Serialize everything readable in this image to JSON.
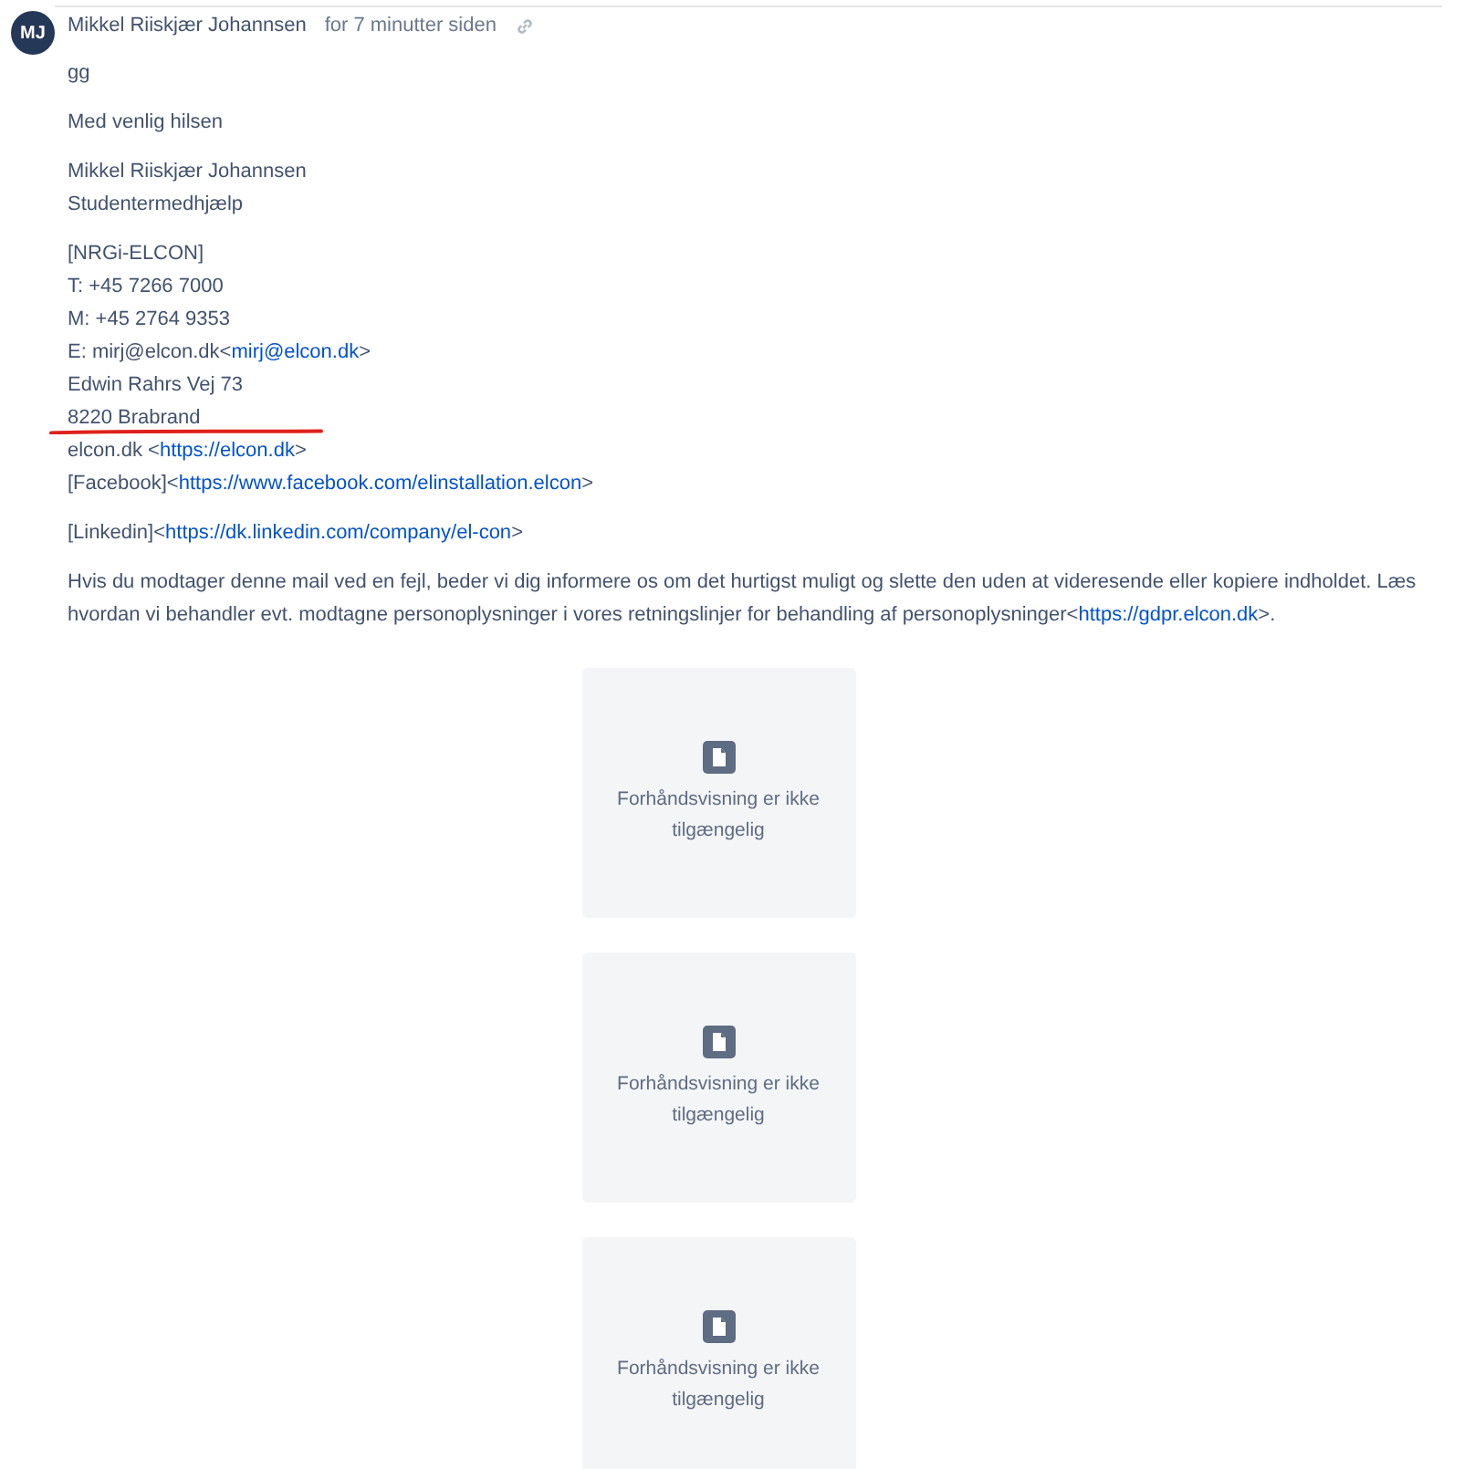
{
  "comment": {
    "avatar_initials": "MJ",
    "author": "Mikkel Riiskjær Johannsen",
    "time": "for 7 minutter siden",
    "paragraphs": [
      [
        [
          {
            "text": "gg"
          }
        ]
      ],
      [
        [
          {
            "text": "Med venlig hilsen"
          }
        ]
      ],
      [
        [
          {
            "text": "Mikkel Riiskjær Johannsen"
          }
        ],
        [
          {
            "text": "Studentermedhjælp"
          }
        ]
      ],
      [
        [
          {
            "text": "[NRGi-ELCON]"
          }
        ],
        [
          {
            "text": "T: +45 7266 7000"
          }
        ],
        [
          {
            "text": "M: +45 2764 9353"
          }
        ],
        [
          {
            "text": "E: mirj@elcon.dk<"
          },
          {
            "text": "mirj@elcon.dk",
            "link": true
          },
          {
            "text": ">"
          }
        ],
        [
          {
            "text": "Edwin Rahrs Vej 73"
          }
        ],
        [
          {
            "text": "8220 Brabrand"
          }
        ],
        [
          {
            "text": "elcon.dk <"
          },
          {
            "text": "https://elcon.dk",
            "link": true
          },
          {
            "text": ">"
          }
        ],
        [
          {
            "text": "[Facebook]<"
          },
          {
            "text": "https://www.facebook.com/elinstallation.elcon",
            "link": true
          },
          {
            "text": ">"
          }
        ]
      ],
      [
        [
          {
            "text": "[Linkedin]<"
          },
          {
            "text": "https://dk.linkedin.com/company/el-con",
            "link": true
          },
          {
            "text": ">"
          }
        ]
      ],
      [
        [
          {
            "text": "Hvis du modtager denne mail ved en fejl, beder vi dig informere os om det hurtigst muligt og slette den uden at videresende eller kopiere indholdet. Læs hvordan vi behandler evt. modtagne personoplysninger i vores retningslinjer for behandling af personoplysninger<"
          },
          {
            "text": "https://gdpr.elcon.dk",
            "link": true
          },
          {
            "text": ">."
          }
        ]
      ]
    ],
    "attachments": [
      {
        "message": "Forhåndsvisning er ikke tilgængelig"
      },
      {
        "message": "Forhåndsvisning er ikke tilgængelig"
      },
      {
        "message": "Forhåndsvisning er ikke tilgængelig"
      }
    ]
  }
}
